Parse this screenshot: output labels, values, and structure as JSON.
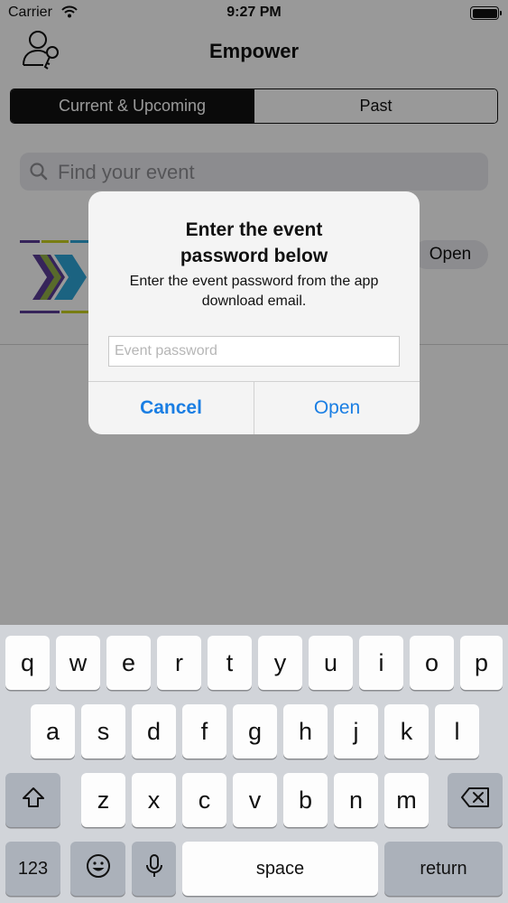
{
  "status_bar": {
    "carrier": "Carrier",
    "time": "9:27 PM"
  },
  "nav": {
    "title": "Empower"
  },
  "segments": {
    "current": "Current & Upcoming",
    "past": "Past"
  },
  "search": {
    "placeholder": "Find your event"
  },
  "event_row": {
    "open_label": "Open"
  },
  "alert": {
    "title_line1": "Enter the event",
    "title_line2": "password below",
    "message_line1": "Enter the event password from the app",
    "message_line2": "download email.",
    "input_placeholder": "Event password",
    "input_value": "",
    "cancel_label": "Cancel",
    "open_label": "Open"
  },
  "keyboard": {
    "row1": [
      "q",
      "w",
      "e",
      "r",
      "t",
      "y",
      "u",
      "i",
      "o",
      "p"
    ],
    "row2": [
      "a",
      "s",
      "d",
      "f",
      "g",
      "h",
      "j",
      "k",
      "l"
    ],
    "row3": [
      "z",
      "x",
      "c",
      "v",
      "b",
      "n",
      "m"
    ],
    "numbers_label": "123",
    "space_label": "space",
    "return_label": "return"
  },
  "colors": {
    "accent": "#1a7ee3",
    "segment_active": "#111111"
  }
}
